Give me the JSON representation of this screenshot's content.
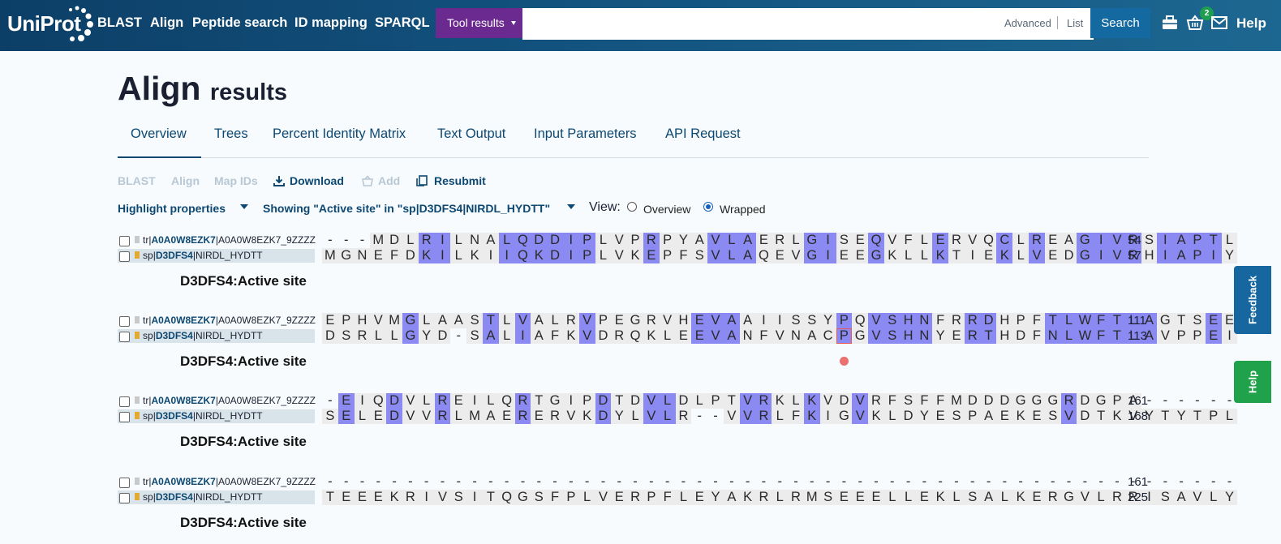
{
  "header": {
    "logo": "UniProt",
    "nav": [
      "BLAST",
      "Align",
      "Peptide search",
      "ID mapping",
      "SPARQL"
    ],
    "tool_results": "Tool results",
    "search_placeholder": "",
    "advanced": "Advanced",
    "list": "List",
    "search": "Search",
    "basket_count": "2",
    "help": "Help",
    "icons": [
      "toolbox-icon",
      "basket-icon",
      "mail-icon"
    ]
  },
  "page": {
    "title": "Align",
    "title_suffix": "results"
  },
  "tabs": [
    "Overview",
    "Trees",
    "Percent Identity Matrix",
    "Text Output",
    "Input Parameters",
    "API Request"
  ],
  "actions": {
    "blast": "BLAST",
    "align": "Align",
    "map_ids": "Map IDs",
    "download": "Download",
    "add": "Add",
    "resubmit": "Resubmit"
  },
  "controls": {
    "highlight": "Highlight properties",
    "showing": "Showing \"Active site\" in \"sp|D3DFS4|NIRDL_HYDTT\"",
    "view_label": "View:",
    "view_options": [
      "Overview",
      "Wrapped"
    ],
    "view_selected": "Wrapped"
  },
  "feature_label": "D3DFS4:Active site",
  "sequences": [
    {
      "db": "tr",
      "acc": "A0A0W8EZK7",
      "id": "A0A0W8EZK7_9ZZZZ"
    },
    {
      "db": "sp",
      "acc": "D3DFS4",
      "id": "NIRDL_HYDTT"
    }
  ],
  "blocks": [
    {
      "rows": [
        {
          "seq": "---MDLRILNALQDDIPLVPRPYAVLAERLGISEQVFLERVQCLREAGIVRSIAPTL",
          "end": "54"
        },
        {
          "seq": "MGNEFDKILKIIQKDIPLVKEPFSVLAQEVGIEEGKLLKTIEKLVEDGIVRHIAPIY",
          "end": "57"
        }
      ],
      "highlight_cols": [
        6,
        7,
        11,
        12,
        13,
        14,
        15,
        16,
        20,
        24,
        25,
        26,
        30,
        31,
        34,
        38,
        42,
        44,
        47,
        48,
        49,
        50,
        52,
        53,
        54,
        55
      ]
    },
    {
      "rows": [
        {
          "seq": "EPHVMGLAASTLVALRVPEGRVHEVAAIISSYPQVSHNFRRDHPFTLWFTLAGTSEE",
          "end": "111"
        },
        {
          "seq": "DSRLLGYD-SALIAFKVDRQKLEEVANFVNACPGVSHNYERTHDFNLWFTLAVPPEI",
          "end": "113"
        }
      ],
      "highlight_cols": [
        5,
        10,
        12,
        16,
        23,
        24,
        25,
        32,
        34,
        35,
        36,
        37,
        40,
        41,
        45,
        46,
        47,
        48,
        49,
        50,
        51,
        55
      ],
      "active_col": 32
    },
    {
      "rows": [
        {
          "seq": "-EIQDVLREILQRTGIPDTDVLDLPTVRKLKVDVRFSFFMDDDGGGRDGPA------",
          "end": "161"
        },
        {
          "seq": "SELEDVVRLMAERERVKDYLVLR--VVRLFKIGVKLDYESPAEKESVDTKVYTYTPL",
          "end": "168"
        }
      ],
      "highlight_cols": [
        1,
        4,
        7,
        12,
        17,
        20,
        21,
        26,
        27,
        30,
        33,
        46
      ]
    },
    {
      "rows": [
        {
          "seq": "---------------------------------------------------------",
          "end": "161"
        },
        {
          "seq": "TEEEKRIVSITQGSFPLVERPFLEYAKRLRMSEEELLEKLSALKERGVLRRISAVLY",
          "end": "225"
        }
      ],
      "highlight_cols": []
    }
  ],
  "side_buttons": {
    "feedback": "Feedback",
    "help": "Help"
  },
  "colors": {
    "header": "#0c3f67",
    "tool_results": "#6b2a8f",
    "search": "#1469a0",
    "highlight": "#8a8af2",
    "feedback": "#1666a0",
    "help": "#20a24a"
  }
}
